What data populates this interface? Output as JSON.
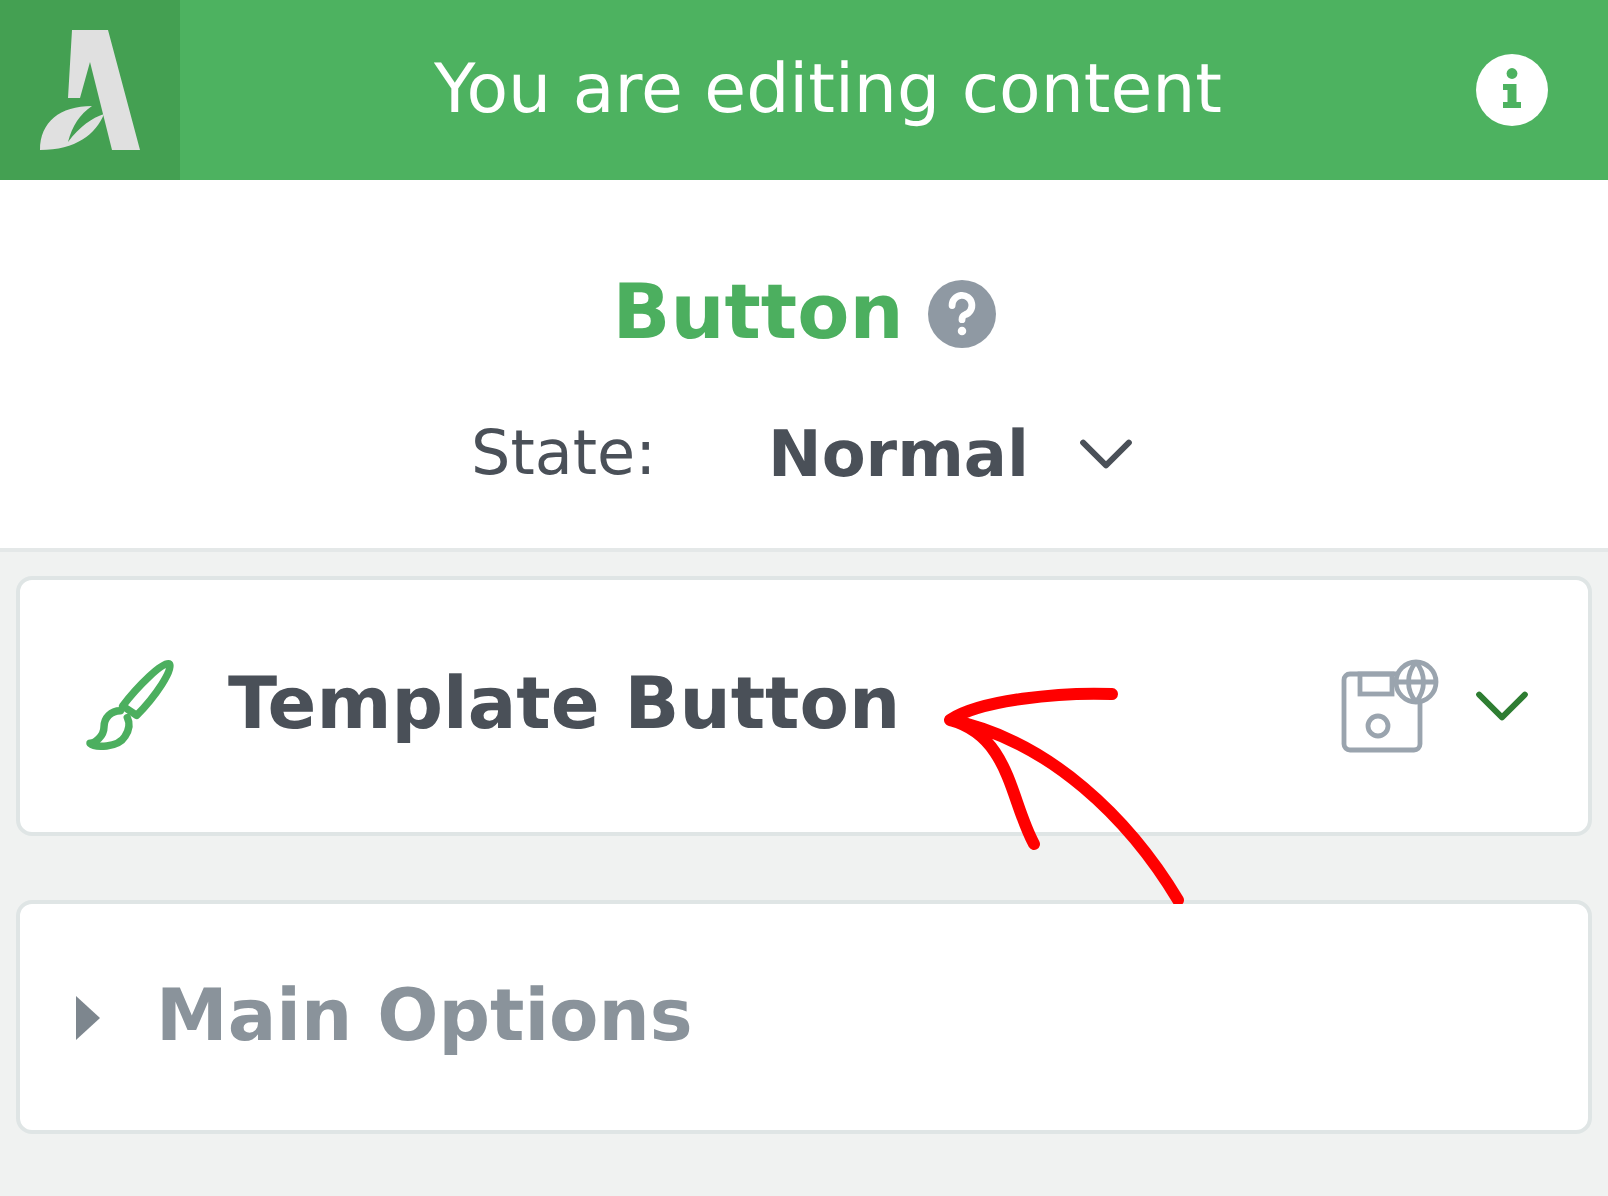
{
  "header": {
    "title": "You are editing content"
  },
  "element": {
    "title": "Button",
    "state_label": "State:",
    "state_value": "Normal"
  },
  "panels": [
    {
      "title": "Template Button",
      "kind": "template",
      "expanded": true
    },
    {
      "title": "Main Options",
      "kind": "section",
      "expanded": false
    }
  ]
}
